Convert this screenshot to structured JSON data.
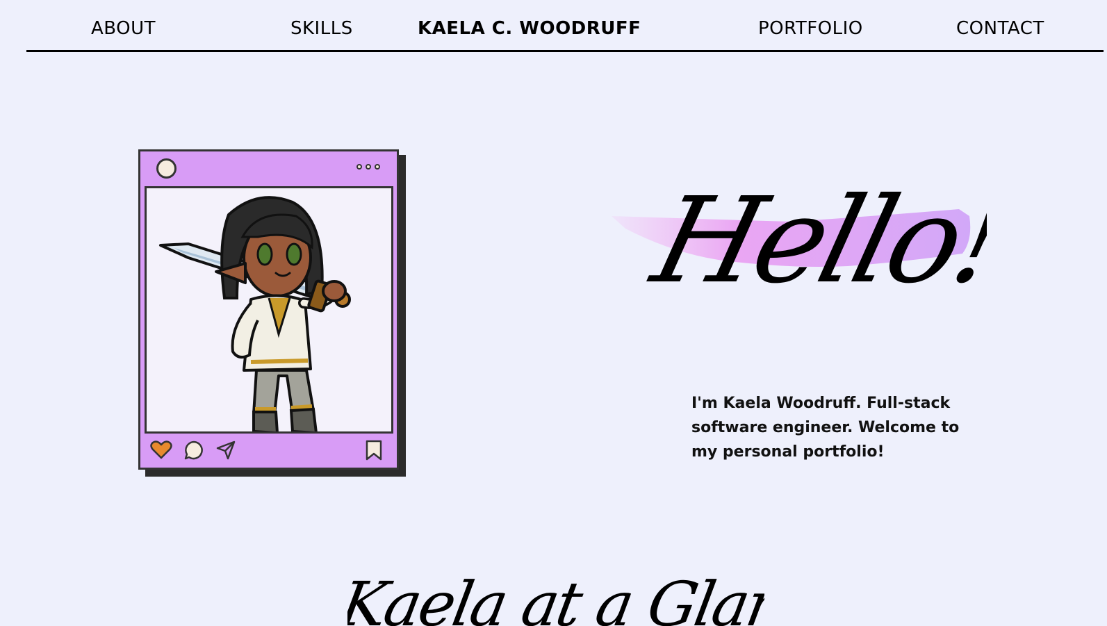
{
  "nav": {
    "about": "ABOUT",
    "skills": "SKILLS",
    "brand": "KAELA C. WOODRUFF",
    "portfolio": "PORTFOLIO",
    "contact": "CONTACT"
  },
  "hero": {
    "greeting": "Hello!",
    "intro": "I'm Kaela Woodruff. Full-stack software engineer. Welcome to my personal portfolio!"
  },
  "section": {
    "title": "Kaela at a Glance"
  },
  "colors": {
    "background": "#eef0fc",
    "card": "#d89cf6",
    "brush": "#e5a8f4",
    "heart": "#e88a2e"
  },
  "icons": {
    "card_actions": [
      "heart-icon",
      "comment-icon",
      "send-icon",
      "bookmark-icon"
    ],
    "card_menu": "more-dots-icon"
  }
}
